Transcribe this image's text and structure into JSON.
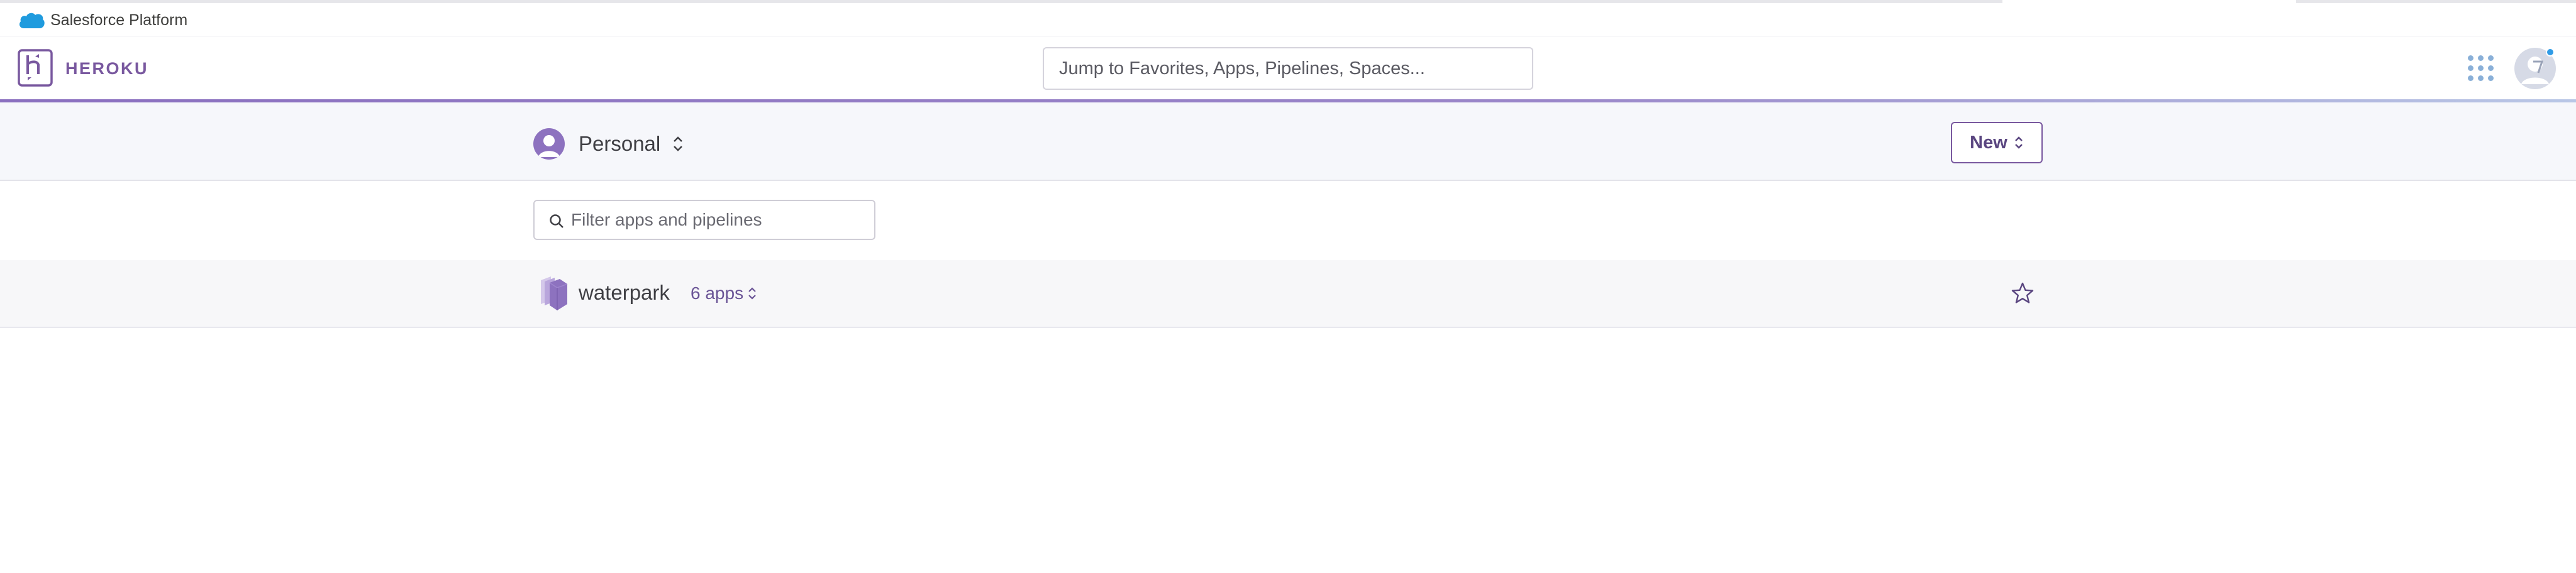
{
  "salesforce_bar": {
    "label": "Salesforce Platform",
    "cloud_icon": "salesforce-cloud-icon",
    "cloud_color": "#1f9bde"
  },
  "header": {
    "logo_icon": "heroku-logo-icon",
    "brand": "HEROKU",
    "brand_color": "#79589f",
    "jump_placeholder": "Jump to Favorites, Apps, Pipelines, Spaces...",
    "apps_grid_icon": "apps-grid-icon",
    "avatar_icon": "user-avatar-icon",
    "notification_color": "#2f9be6"
  },
  "context": {
    "team_label": "Personal",
    "team_icon": "personal-avatar-icon",
    "new_label": "New"
  },
  "filter": {
    "placeholder": "Filter apps and pipelines",
    "icon": "search-icon"
  },
  "pipelines": [
    {
      "name": "waterpark",
      "apps_count": "6 apps",
      "icon": "pipeline-icon",
      "favorite_icon": "star-icon",
      "favorited": false
    }
  ]
}
